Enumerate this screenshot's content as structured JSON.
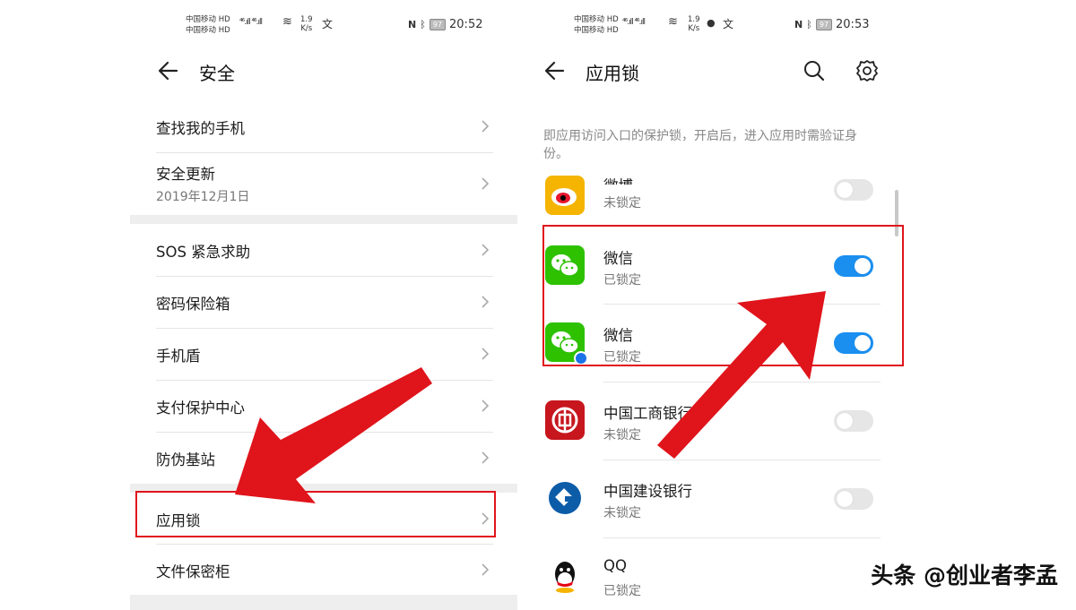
{
  "left": {
    "status": {
      "carrier1": "中国移动 HD",
      "carrier2": "中国移动 HD",
      "signal": "⁴⁶.ıll ⁴⁶.ıll",
      "speed_value": "1.9",
      "speed_unit": "K/s",
      "battery": "97",
      "time": "20:52"
    },
    "title": "安全",
    "items": [
      {
        "label": "查找我的手机"
      },
      {
        "label": "安全更新",
        "sub": "2019年12月1日"
      },
      {
        "label": "SOS 紧急求助"
      },
      {
        "label": "密码保险箱"
      },
      {
        "label": "手机盾"
      },
      {
        "label": "支付保护中心"
      },
      {
        "label": "防伪基站"
      },
      {
        "label": "应用锁"
      },
      {
        "label": "文件保密柜"
      }
    ]
  },
  "right": {
    "status": {
      "carrier1": "中国移动 HD",
      "carrier2": "中国移动 HD",
      "signal": "⁴⁶.ıll ⁴⁶.ıll",
      "speed_value": "1.9",
      "speed_unit": "K/s",
      "battery": "97",
      "time": "20:53"
    },
    "title": "应用锁",
    "description": "即应用访问入口的保护锁，开启后，进入应用时需验证身份。",
    "apps": [
      {
        "name": "微博",
        "state": "未锁定",
        "locked": false,
        "icon": "weibo-icon"
      },
      {
        "name": "微信",
        "state": "已锁定",
        "locked": true,
        "icon": "wechat-icon"
      },
      {
        "name": "微信",
        "state": "已锁定",
        "locked": true,
        "icon": "wechat-clone-icon"
      },
      {
        "name": "中国工商银行",
        "state": "未锁定",
        "locked": false,
        "icon": "icbc-icon"
      },
      {
        "name": "中国建设银行",
        "state": "未锁定",
        "locked": false,
        "icon": "ccb-icon"
      },
      {
        "name": "QQ",
        "state": "已锁定",
        "locked": false,
        "icon": "qq-icon"
      }
    ]
  },
  "watermark": "头条 @创业者李孟",
  "colors": {
    "accent_red": "#e0141b",
    "toggle_on": "#1a8ff0",
    "wechat_green": "#2dc100"
  }
}
